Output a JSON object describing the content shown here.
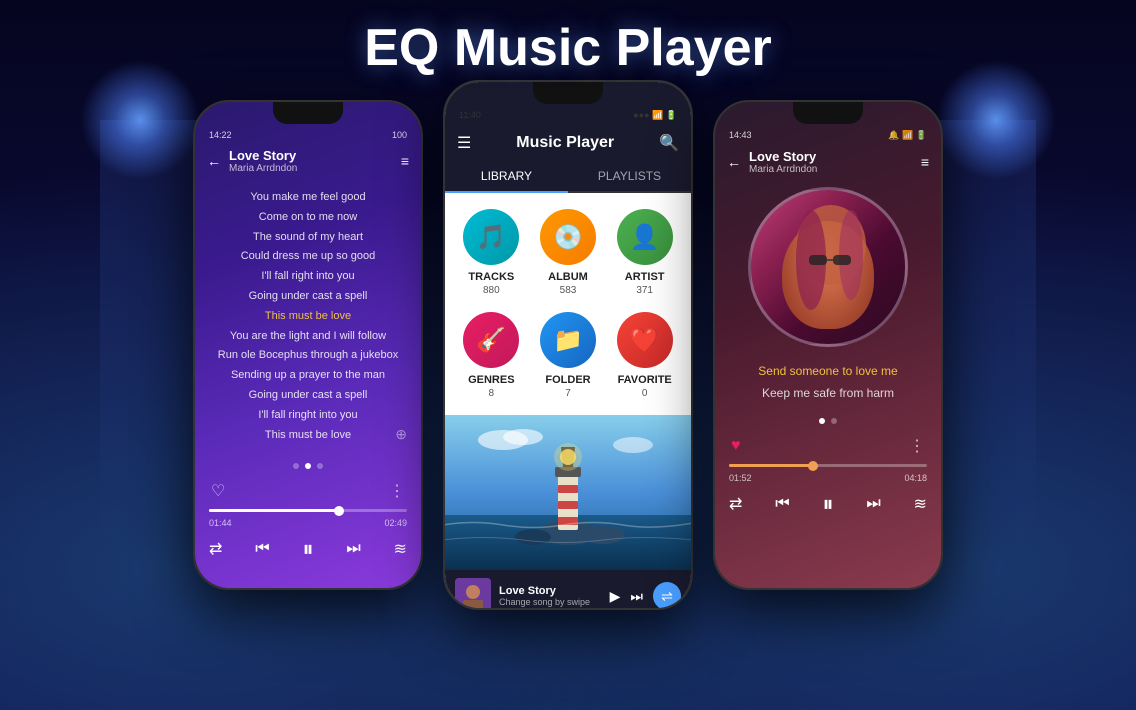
{
  "page": {
    "title": "EQ Music Player"
  },
  "phone1": {
    "status_left": "14:22",
    "status_right": "100",
    "song_title": "Love Story",
    "artist": "Maria Arrdndon",
    "lyrics": [
      {
        "text": "You make me feel good",
        "highlight": false
      },
      {
        "text": "Come on to me now",
        "highlight": false
      },
      {
        "text": "The sound of my heart",
        "highlight": false
      },
      {
        "text": "Could dress me up so good",
        "highlight": false
      },
      {
        "text": "I'll fall right into you",
        "highlight": false
      },
      {
        "text": "Going under cast a spell",
        "highlight": false
      },
      {
        "text": "This must be love",
        "highlight": true
      },
      {
        "text": "You are the light and I will follow",
        "highlight": false
      },
      {
        "text": "Run ole Bocephus through a jukebox",
        "highlight": false
      },
      {
        "text": "Sending up a prayer to the man",
        "highlight": false
      },
      {
        "text": "Going under cast a spell",
        "highlight": false
      },
      {
        "text": "I'll fall ringht into you",
        "highlight": false
      },
      {
        "text": "This must be love",
        "highlight": false
      }
    ],
    "time_current": "01:44",
    "time_total": "02:49",
    "progress_percent": 65
  },
  "phone2": {
    "status_left": "11:40",
    "app_name": "Music Player",
    "tab_library": "LIBRARY",
    "tab_playlists": "PLAYLISTS",
    "library_items": [
      {
        "label": "TRACKS",
        "count": "880",
        "color": "cyan"
      },
      {
        "label": "ALBUM",
        "count": "583",
        "color": "orange"
      },
      {
        "label": "ARTIST",
        "count": "371",
        "color": "green"
      },
      {
        "label": "GENRES",
        "count": "8",
        "color": "pink"
      },
      {
        "label": "FOLDER",
        "count": "7",
        "color": "blue"
      },
      {
        "label": "FAVORITE",
        "count": "0",
        "color": "red"
      }
    ],
    "now_playing_title": "Love Story",
    "now_playing_sub": "Change song by swipe"
  },
  "phone3": {
    "status_left": "14:43",
    "song_title": "Love Story",
    "artist": "Maria Arrdndon",
    "lyrics_active": "Send someone to love me",
    "lyrics_normal": "Keep me safe from harm",
    "time_current": "01:52",
    "time_total": "04:18",
    "progress_percent": 42
  },
  "icons": {
    "back": "←",
    "queue": "≡",
    "heart": "♡",
    "heart_filled": "♥",
    "more": "⋮",
    "prev": "⏮",
    "next": "⏭",
    "pause": "⏸",
    "play": "▶",
    "repeat": "⇄",
    "equalizer": "≋",
    "shuffle": "⇌",
    "search": "🔍",
    "hamburger": "☰",
    "zoom": "⊕"
  }
}
